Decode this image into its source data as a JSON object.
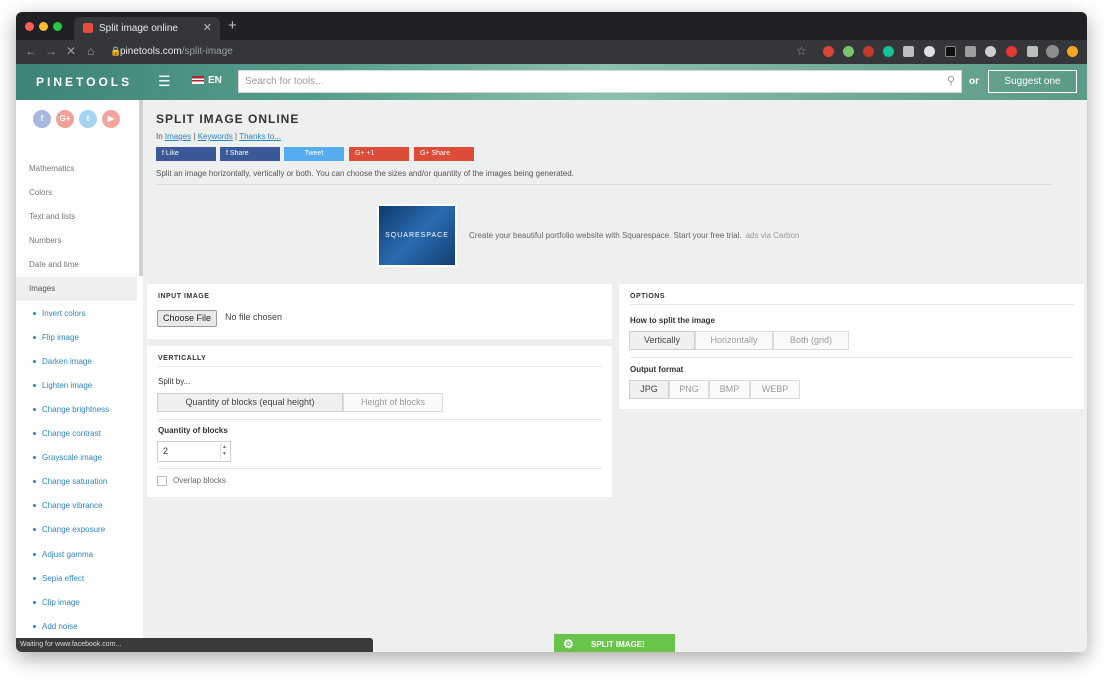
{
  "browser": {
    "tab_title": "Split image online",
    "new_tab": "+",
    "url_host": "pinetools.com",
    "url_path": "/split-image"
  },
  "site": {
    "logo": "PINETOOLS",
    "lang": "EN",
    "search_placeholder": "Search for tools...",
    "or_label": "or",
    "suggest_label": "Suggest one"
  },
  "sidebar": {
    "social": [
      "f",
      "G+",
      "t",
      "▶"
    ],
    "categories": [
      "Mathematics",
      "Colors",
      "Text and lists",
      "Numbers",
      "Date and time",
      "Images"
    ],
    "image_tools": [
      "Invert colors",
      "Flip image",
      "Darken image",
      "Lighten image",
      "Change brightness",
      "Change contrast",
      "Grayscale image",
      "Change saturation",
      "Change vibrance",
      "Change exposure",
      "Adjust gamma",
      "Sepia effect",
      "Clip image",
      "Add noise"
    ]
  },
  "page": {
    "title": "SPLIT IMAGE ONLINE",
    "crumb_in": "In",
    "crumb_images": "Images",
    "crumb_keywords": "Keywords",
    "crumb_thanks": "Thanks to...",
    "share_buttons": {
      "fb_like": "f    Like",
      "fb_share": "f    Share",
      "tweet": "Tweet",
      "gplus_one": "G+    +1",
      "gplus_share": "G+    Share"
    },
    "description": "Split an image horizontally, vertically or both. You can choose the sizes and/or quantity of the images being generated.",
    "ad": {
      "image_text": "SQUARESPACE",
      "text": "Create your beautiful portfolio website with Squarespace. Start your free trial.",
      "via": "ads via Carbon"
    }
  },
  "input_image": {
    "title": "INPUT IMAGE",
    "choose_file": "Choose File",
    "no_file": "No file chosen"
  },
  "vertically": {
    "title": "VERTICALLY",
    "split_by_label": "Split by...",
    "split_by_options": [
      "Quantity of blocks (equal height)",
      "Height of blocks"
    ],
    "split_by_selected": "Quantity of blocks (equal height)",
    "quantity_label": "Quantity of blocks",
    "quantity_value": "2",
    "overlap_label": "Overlap blocks"
  },
  "options": {
    "title": "OPTIONS",
    "how_label": "How to split the image",
    "how_options": [
      "Vertically",
      "Horizontally",
      "Both (grid)"
    ],
    "how_selected": "Vertically",
    "format_label": "Output format",
    "format_options": [
      "JPG",
      "PNG",
      "BMP",
      "WEBP"
    ],
    "format_selected": "JPG"
  },
  "action": {
    "split_label": "SPLIT IMAGE!"
  },
  "status": "Waiting for www.facebook.com...",
  "colors": {
    "accent": "#2e86c1",
    "split_button": "#68c44b",
    "header": "#58a08d"
  }
}
